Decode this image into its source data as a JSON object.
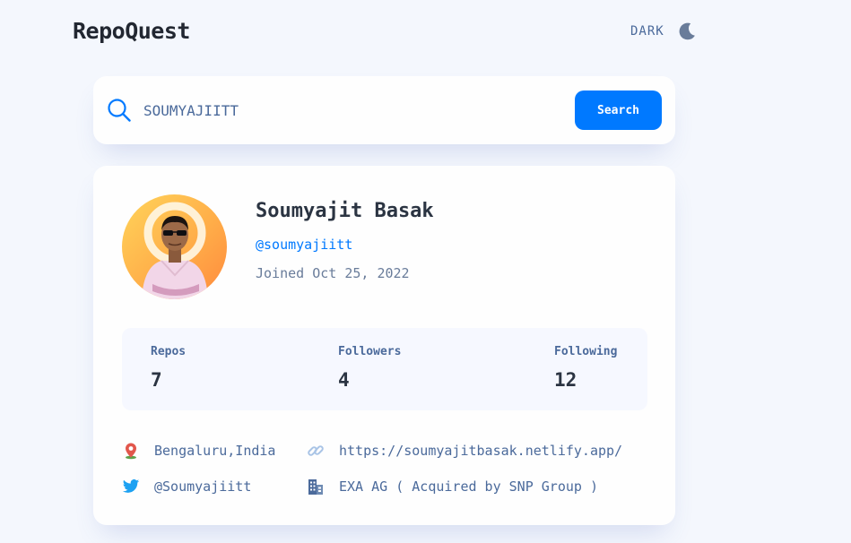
{
  "app": {
    "title": "RepoQuest"
  },
  "theme": {
    "label": "DARK",
    "icon": "moon-icon"
  },
  "search": {
    "value": "SOUMYAJIITT",
    "button_label": "Search",
    "icon": "search-icon"
  },
  "profile": {
    "name": "Soumyajit Basak",
    "login": "@soumyajiitt",
    "joined": "Joined Oct 25, 2022",
    "stats": [
      {
        "label": "Repos",
        "value": "7"
      },
      {
        "label": "Followers",
        "value": "4"
      },
      {
        "label": "Following",
        "value": "12"
      }
    ],
    "location": "Bengaluru,India",
    "website": "https://soumyajitbasak.netlify.app/",
    "twitter": "@Soumyajiitt",
    "company": "EXA AG ( Acquired by SNP Group )"
  },
  "colors": {
    "accent": "#0079ff",
    "background": "#f4f7fd",
    "card": "#fefefe",
    "muted_text": "#4b6a9b"
  }
}
